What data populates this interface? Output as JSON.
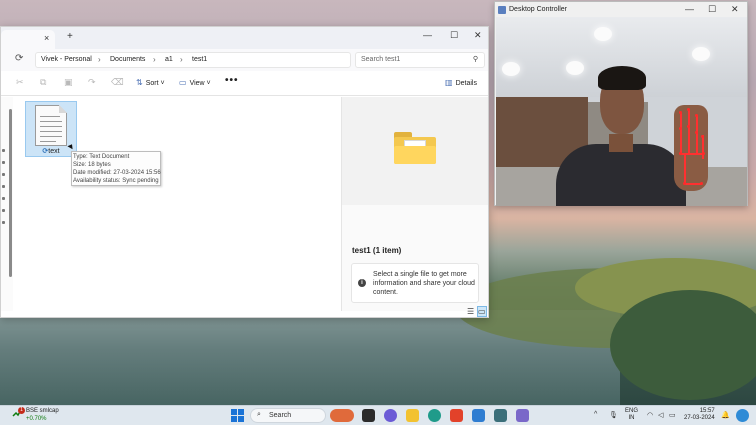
{
  "explorer": {
    "tab_close": "×",
    "new_tab": "+",
    "window_controls": {
      "minimize": "—",
      "maximize": "☐",
      "close": "✕"
    },
    "breadcrumbs": [
      "Vivek - Personal",
      "Documents",
      "a1",
      "test1"
    ],
    "breadcrumb_separator": "›",
    "search_placeholder": "Search test1",
    "toolbar": {
      "sort_label": "Sort",
      "view_label": "View",
      "more_label": "•••",
      "details_label": "Details"
    },
    "file": {
      "name": "text",
      "sync_glyph": "⟳"
    },
    "tooltip": {
      "type": "Type: Text Document",
      "size": "Size: 18 bytes",
      "modified": "Date modified: 27-03-2024 15:56",
      "availability": "Availability status: Sync pending"
    },
    "details_pane": {
      "title": "test1 (1 item)",
      "info_icon": "i",
      "info_text": "Select a single file to get more information and share your cloud content."
    }
  },
  "controller": {
    "title": "Desktop Controller",
    "controls": {
      "minimize": "—",
      "maximize": "☐",
      "close": "✕"
    }
  },
  "taskbar": {
    "stock_badge": "1",
    "stock_name": "BSE smlcap",
    "stock_change": "+0.70%",
    "search_label": "Search",
    "search_icon": "⌕",
    "lang_line1": "ENG",
    "lang_line2": "IN",
    "time": "15:57",
    "date": "27-03-2024",
    "tray_chevron": "^"
  },
  "colors": {
    "accent": "#1a73d6",
    "selection": "#cce4f7",
    "folder": "#f4c84f",
    "landmark": "#ff2a2a",
    "stock_up": "#0f7b0f"
  },
  "icons": [
    "refresh-icon",
    "search-icon",
    "sort-icon",
    "view-icon",
    "details-icon",
    "text-document-icon",
    "folder-icon",
    "info-icon",
    "windows-start-icon"
  ]
}
